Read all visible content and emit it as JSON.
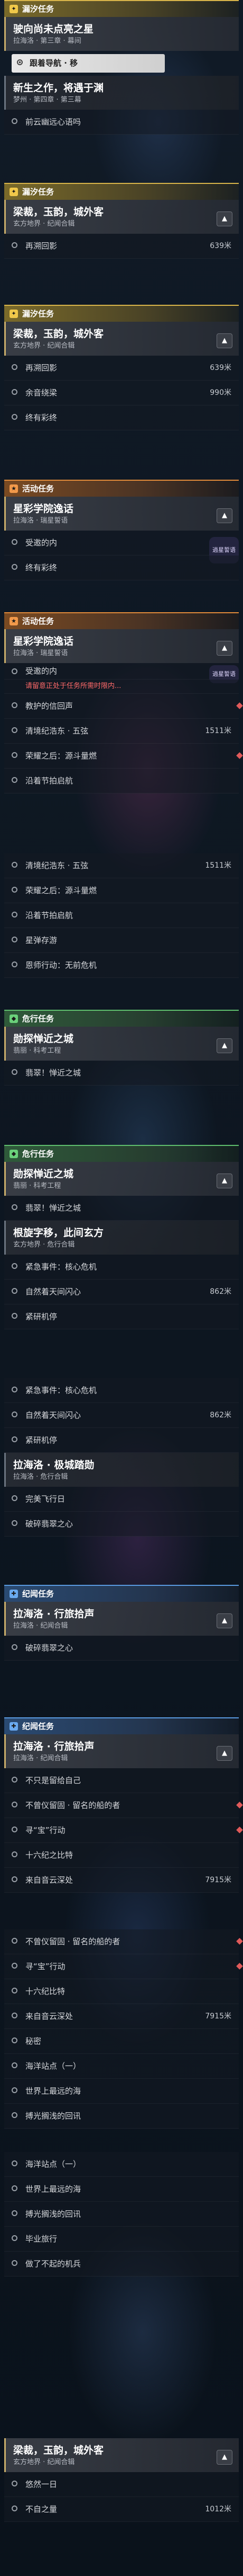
{
  "colors": {
    "yellow": "#d9b54a",
    "orange": "#e08a3a",
    "green": "#5fbf6e",
    "blue": "#5a9ae0",
    "alert": "#ff6a6a"
  },
  "s1": {
    "category": "漏汐任务",
    "q1": {
      "title": "驶向尚未点亮之星",
      "sub": "拉海洛 · 第三章 · 幕间"
    },
    "active": "跟着导航 · 移",
    "q2": {
      "title": "新生之作，将遇于渊",
      "sub": "梦州 · 第四章 · 第三幕"
    },
    "s1_item": "前云幽远心语吗"
  },
  "s2": {
    "category": "漏汐任务",
    "quest": {
      "title": "梁裁，玉韵，城外客",
      "sub": "玄方地界 · 纪闻合辑"
    },
    "items": [
      {
        "label": "再溯回影",
        "dist": "639米"
      }
    ]
  },
  "s3": {
    "category": "漏汐任务",
    "quest": {
      "title": "梁裁，玉韵，城外客",
      "sub": "玄方地界 · 纪闻合辑"
    },
    "items": [
      {
        "label": "再溯回影",
        "dist": "639米"
      },
      {
        "label": "余音绕梁",
        "dist": "990米"
      },
      {
        "label": "终有彩终",
        "dist": ""
      }
    ]
  },
  "s4": {
    "category": "活动任务",
    "quest": {
      "title": "星彩学院逸话",
      "sub": "拉海洛 · 瑞星誓语"
    },
    "badge": "逍星誓语",
    "items": [
      {
        "label": "受邀的内"
      },
      {
        "label": "终有彩终"
      }
    ]
  },
  "s5": {
    "category": "活动任务",
    "quest": {
      "title": "星彩学院逸话",
      "sub": "拉海洛 · 瑞星誓语"
    },
    "badge": "逍星誓语",
    "items": [
      {
        "label": "受邀的内"
      },
      {
        "label": "请留意正处于任务所需时限内...",
        "alert": true
      },
      {
        "label": "教护的信回声"
      },
      {
        "label": "清境纪浩东 · 五弦",
        "dist": "1511米"
      },
      {
        "label": "荣耀之后：源斗量燃"
      },
      {
        "label": "沿着节拍启航"
      }
    ]
  },
  "s6": {
    "items": [
      {
        "label": "清境纪浩东 · 五弦",
        "dist": "1511米"
      },
      {
        "label": "荣耀之后：源斗量燃"
      },
      {
        "label": "沿着节拍启航"
      },
      {
        "label": "星弹存游"
      },
      {
        "label": "恩师行动：无前危机"
      }
    ]
  },
  "s7": {
    "category": "危行任务",
    "quest": {
      "title": "勋探惮近之城",
      "sub": "翡丽 · 科考工程"
    },
    "items": [
      {
        "label": "翡翠！惮近之城"
      }
    ]
  },
  "s8": {
    "category": "危行任务",
    "quest": {
      "title": "勋探惮近之城",
      "sub": "翡丽 · 科考工程"
    },
    "items": [
      {
        "label": "翡翠！惮近之城"
      }
    ],
    "quest2": {
      "title": "根旋字移，此间玄方",
      "sub": "玄方地界 · 危行合辑"
    },
    "items2": [
      {
        "label": "紧急事件：核心危机"
      },
      {
        "label": "自然着天间闪心",
        "dist": "862米"
      },
      {
        "label": "紧研机停"
      }
    ]
  },
  "s9": {
    "items": [
      {
        "label": "紧急事件：核心危机"
      },
      {
        "label": "自然着天间闪心",
        "dist": "862米"
      },
      {
        "label": "紧研机停"
      }
    ],
    "quest": {
      "title": "拉海洛 · 极城踏勋",
      "sub": "拉海洛 · 危行合辑"
    },
    "items2": [
      {
        "label": "完美飞行日"
      },
      {
        "label": "破碎翡翠之心"
      }
    ]
  },
  "s10": {
    "category": "纪闻任务",
    "quest": {
      "title": "拉海洛 · 行旅拾声",
      "sub": "拉海洛 · 纪闻合辑"
    },
    "items": [
      {
        "label": "破碎翡翠之心"
      }
    ]
  },
  "s11": {
    "category": "纪闻任务",
    "quest": {
      "title": "拉海洛 · 行旅拾声",
      "sub": "拉海洛 · 纪闻合辑"
    },
    "items": [
      {
        "label": "不只是留给自己"
      },
      {
        "label": "不曾仪留固 · 留名的船的者"
      },
      {
        "label": "寻“宝”行动"
      },
      {
        "label": "十六纪之比特"
      },
      {
        "label": "来自音云深处",
        "dist": "7915米"
      }
    ]
  },
  "s12": {
    "items": [
      {
        "label": "不曾仪留固 · 留名的船的者"
      },
      {
        "label": "寻“宝”行动"
      },
      {
        "label": "十六纪比特"
      },
      {
        "label": "来自音云深处",
        "dist": "7915米"
      },
      {
        "label": "秘密"
      },
      {
        "label": "海洋站点（一）"
      },
      {
        "label": "世界上最远的海"
      },
      {
        "label": "搏光搁浅的回讯"
      }
    ]
  },
  "s13": {
    "items": [
      {
        "label": "海洋站点（一）"
      },
      {
        "label": "世界上最远的海"
      },
      {
        "label": "搏光搁浅的回讯"
      },
      {
        "label": "毕业旅行"
      },
      {
        "label": "做了不起的机兵"
      }
    ]
  },
  "s14": {
    "quest": {
      "title": "梁裁，玉韵，城外客",
      "sub": "玄方地界 · 纪闻合辑"
    },
    "items": [
      {
        "label": "悠然一日"
      },
      {
        "label": "不自之量",
        "dist": "1012米"
      }
    ]
  }
}
